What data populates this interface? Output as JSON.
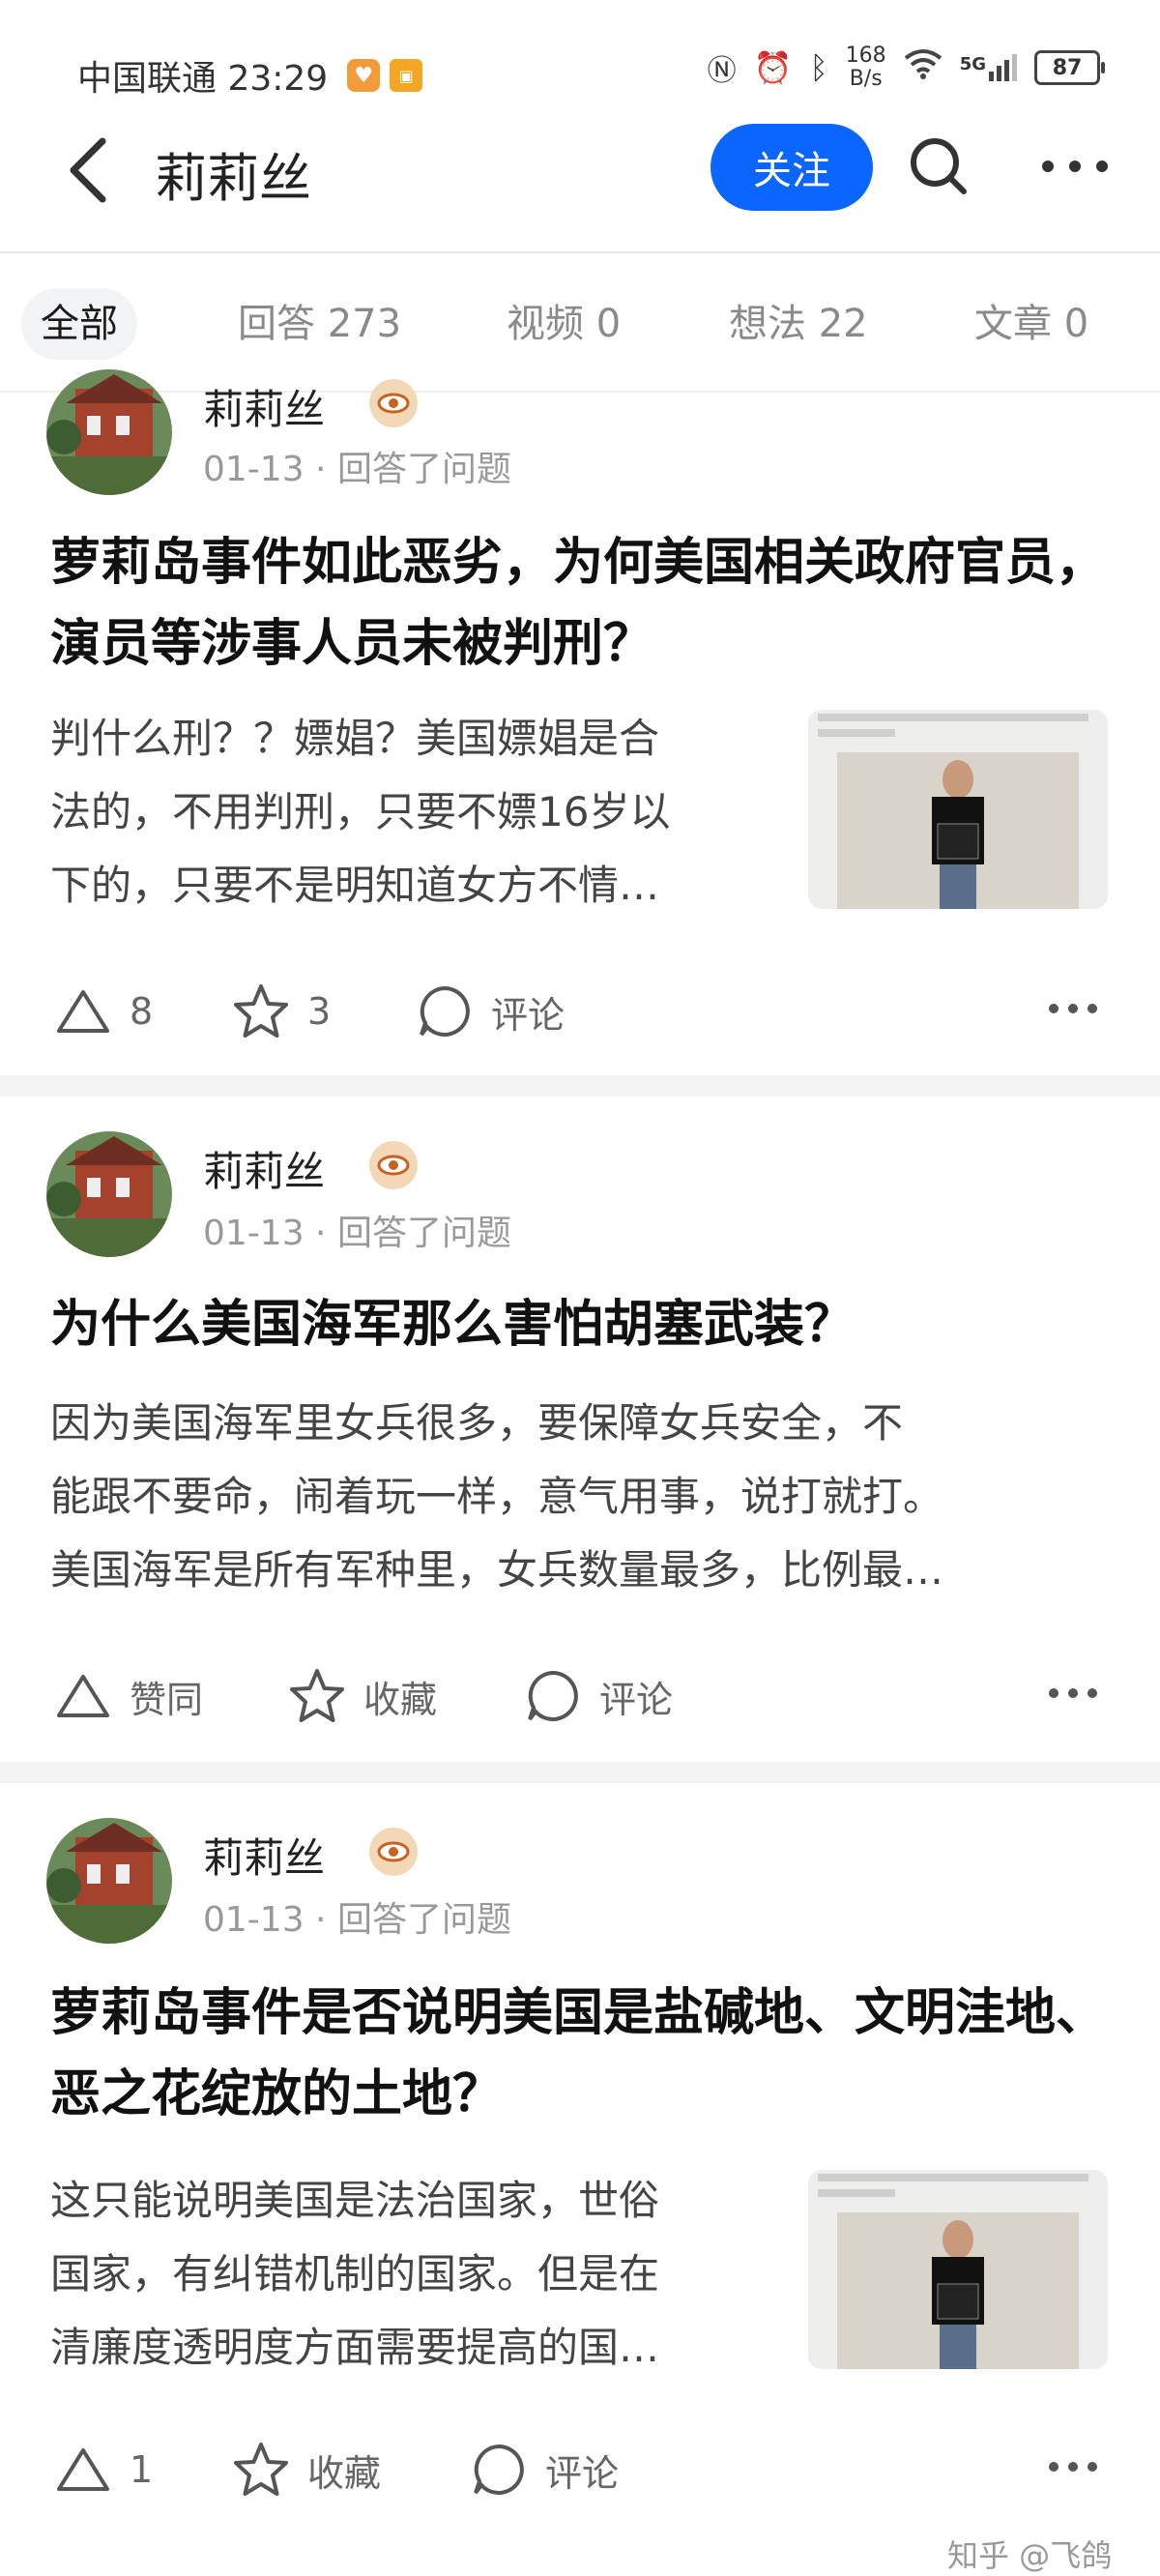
{
  "status_bar": {
    "carrier_time": "中国联通 23:29",
    "net_speed_value": "168",
    "net_speed_unit": "B/s",
    "signal": "5G",
    "battery": "87"
  },
  "header": {
    "title": "莉莉丝",
    "follow_label": "关注"
  },
  "tabs": [
    {
      "label": "全部"
    },
    {
      "label": "回答 273"
    },
    {
      "label": "视频 0"
    },
    {
      "label": "想法 22"
    },
    {
      "label": "文章 0"
    }
  ],
  "cards": [
    {
      "author": "莉莉丝",
      "meta": "01-13 · 回答了问题",
      "question": "萝莉岛事件如此恶劣，为何美国相关政府官员，演员等涉事人员未被判刑？",
      "excerpt_lines": [
        "判什么刑？？嫖娼？美国嫖娼是合",
        "法的，不用判刑，只要不嫖16岁以",
        "下的，只要不是明知道女方不情…"
      ],
      "actions": {
        "upvote": "8",
        "favorite": "3",
        "comment": "评论"
      }
    },
    {
      "author": "莉莉丝",
      "meta": "01-13 · 回答了问题",
      "question": "为什么美国海军那么害怕胡塞武装？",
      "excerpt_lines": [
        "因为美国海军里女兵很多，要保障女兵安全，不",
        "能跟不要命，闹着玩一样，意气用事，说打就打。",
        "美国海军是所有军种里，女兵数量最多，比例最…"
      ],
      "actions": {
        "upvote": "赞同",
        "favorite": "收藏",
        "comment": "评论"
      }
    },
    {
      "author": "莉莉丝",
      "meta": "01-13 · 回答了问题",
      "question": "萝莉岛事件是否说明美国是盐碱地、文明洼地、恶之花绽放的土地？",
      "excerpt_lines": [
        "这只能说明美国是法治国家，世俗",
        "国家，有纠错机制的国家。但是在",
        "清廉度透明度方面需要提高的国…"
      ],
      "actions": {
        "upvote": "1",
        "favorite": "收藏",
        "comment": "评论"
      }
    }
  ],
  "watermark": "知乎 @飞鸽"
}
